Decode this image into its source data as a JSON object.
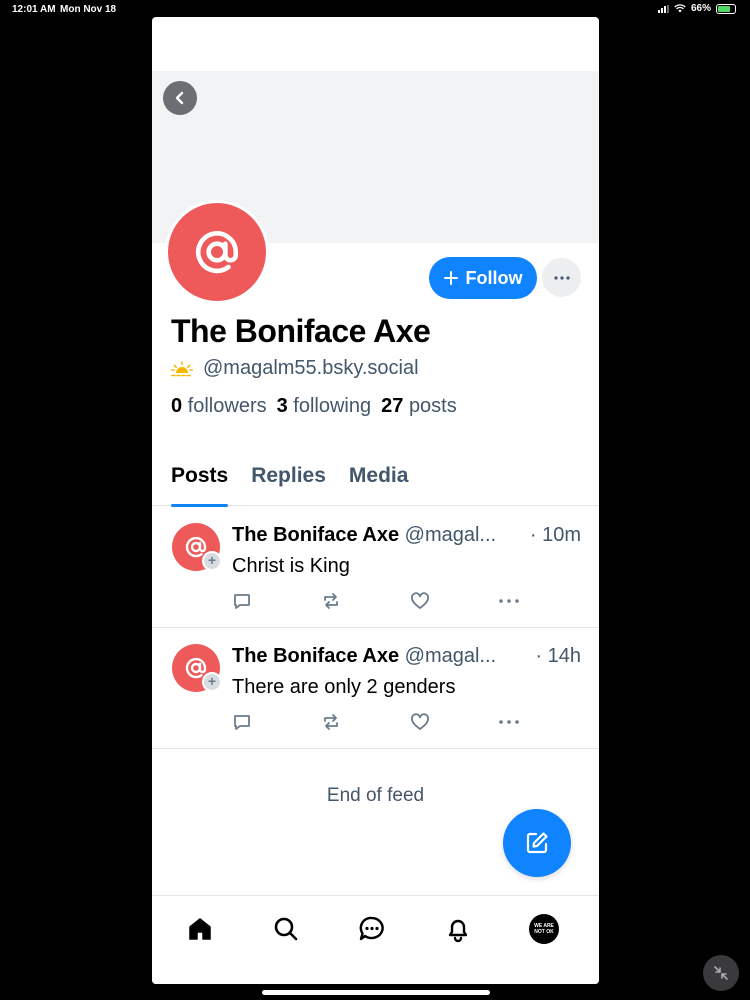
{
  "status_bar": {
    "time": "12:01 AM",
    "date": "Mon Nov 18",
    "battery": "66%"
  },
  "profile": {
    "display_name": "The Boniface Axe",
    "handle": "@magalm55.bsky.social",
    "followers_count": "0",
    "followers_label": "followers",
    "following_count": "3",
    "following_label": "following",
    "posts_count": "27",
    "posts_label": "posts",
    "follow_label": "Follow"
  },
  "tabs": [
    {
      "label": "Posts",
      "active": true
    },
    {
      "label": "Replies",
      "active": false
    },
    {
      "label": "Media",
      "active": false
    }
  ],
  "posts": [
    {
      "author": "The Boniface Axe",
      "handle": "@magal...",
      "time": "· 10m",
      "text": "Christ is King"
    },
    {
      "author": "The Boniface Axe",
      "handle": "@magal...",
      "time": "· 14h",
      "text": "There are only 2 genders"
    }
  ],
  "feed_end": "End of feed",
  "bottom_nav": {
    "avatar_text": "WE ARE NOT OK"
  },
  "colors": {
    "accent": "#1083fe",
    "avatar": "#ee5a5a",
    "muted": "#42576c"
  }
}
